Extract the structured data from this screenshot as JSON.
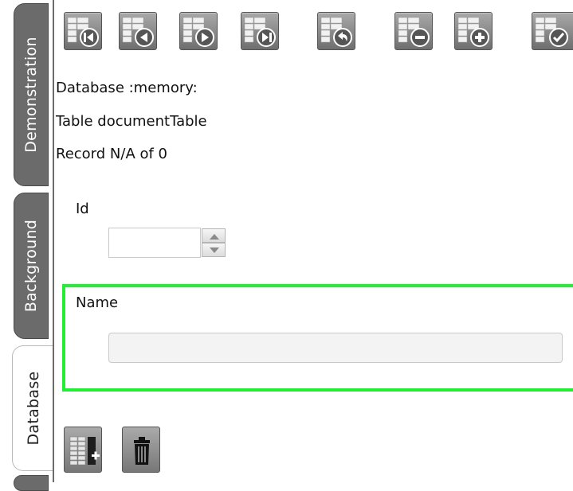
{
  "tabs": [
    {
      "label": "Demonstration",
      "active": false
    },
    {
      "label": "Background",
      "active": false
    },
    {
      "label": "Database",
      "active": true
    }
  ],
  "toolbar": {
    "buttons": [
      {
        "icon": "first-record-icon"
      },
      {
        "icon": "previous-record-icon"
      },
      {
        "icon": "next-record-icon"
      },
      {
        "icon": "last-record-icon"
      },
      {
        "icon": "undo-record-icon"
      },
      {
        "icon": "delete-record-icon"
      },
      {
        "icon": "add-record-icon"
      },
      {
        "icon": "commit-record-icon"
      }
    ]
  },
  "info": {
    "database": "Database :memory:",
    "table": "Table documentTable",
    "record": "Record N/A of 0"
  },
  "fields": {
    "id_label": "Id",
    "id_value": "",
    "name_label": "Name",
    "name_value": ""
  },
  "bottom_buttons": [
    {
      "icon": "add-column-icon"
    },
    {
      "icon": "trash-icon"
    }
  ],
  "colors": {
    "highlight_border": "#22ee33",
    "tab_inactive": "#6b6b6b",
    "button_gray": "#8a8a8a"
  }
}
